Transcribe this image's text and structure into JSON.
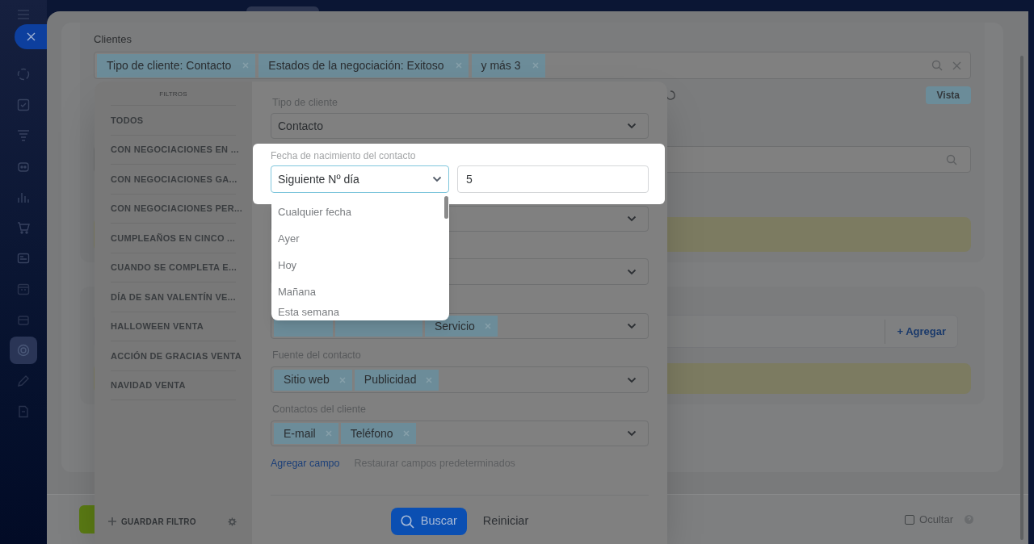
{
  "sidebar": {
    "items": [
      {
        "selected": false
      },
      {
        "selected": false
      },
      {
        "selected": false
      },
      {
        "selected": false
      },
      {
        "selected": false
      },
      {
        "selected": false
      },
      {
        "selected": false
      },
      {
        "selected": false
      },
      {
        "selected": false
      },
      {
        "selected": true
      },
      {
        "selected": false
      },
      {
        "selected": false
      }
    ]
  },
  "page": {
    "title": "Clientes",
    "search_tags": [
      "Tipo de cliente: Contacto",
      "Estados de la negociación: Exitoso",
      "y más 3"
    ],
    "view_button": "Vista",
    "add_button": "+ Agregar",
    "hide_checkbox": {
      "label": "Ocultar",
      "checked": false
    }
  },
  "filter_popup": {
    "heading": "FILTROS",
    "presets": [
      "TODOS",
      "CON NEGOCIACIONES EN ...",
      "CON NEGOCIACIONES GA...",
      "CON NEGOCIACIONES PER...",
      "CUMPLEAÑOS EN CINCO ...",
      "CUANDO SE COMPLETA E...",
      "DÍA DE SAN VALENTÍN VE...",
      "HALLOWEEN VENTA",
      "ACCIÓN DE GRACIAS VENTA",
      "NAVIDAD VENTA"
    ],
    "save_filter": "GUARDAR FILTRO",
    "fields": [
      {
        "kind": "select",
        "label": "Tipo de cliente",
        "value": "Contacto"
      },
      {
        "kind": "date",
        "label": "Fecha de nacimiento del contacto",
        "value": "Siguiente Nº día",
        "number": "5",
        "highlighted": true
      },
      {
        "kind": "select"
      },
      {
        "kind": "select"
      },
      {
        "kind": "tags_covered",
        "tags": [
          "Servicio"
        ]
      },
      {
        "kind": "tags",
        "label": "Fuente del contacto",
        "tags": [
          "Sitio web",
          "Publicidad"
        ]
      },
      {
        "kind": "tags",
        "label": "Contactos del cliente",
        "tags": [
          "E-mail",
          "Teléfono"
        ]
      }
    ],
    "dropdown_options": [
      "Cualquier fecha",
      "Ayer",
      "Hoy",
      "Mañana",
      "Esta semana"
    ],
    "add_field_link": "Agregar campo",
    "restore_link": "Restaurar campos predeterminados",
    "search_button": "Buscar",
    "reset_button": "Reiniciar"
  }
}
